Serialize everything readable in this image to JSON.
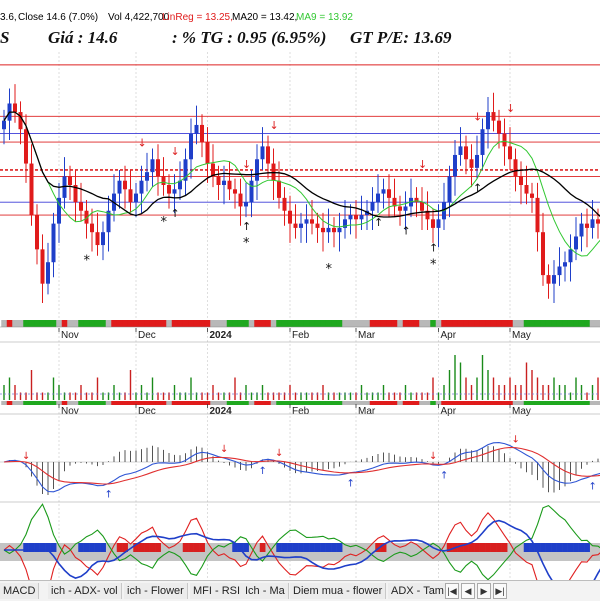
{
  "info_line": {
    "open_fragment": "3.6,",
    "close": "Close 14.6 (7.0%)",
    "vol": "Vol 4,422,700",
    "linreg": "LinReg = 13.25,",
    "ma20": "MA20 = 13.42,",
    "ma9": "MA9 = 13.92"
  },
  "headline": {
    "ticker_fragment": "S",
    "price": "Giá : 14.6",
    "change": ": % TG : 0.95 (6.95%)",
    "pe": "GT P/E: 13.69"
  },
  "colors": {
    "up": "#1f3fc9",
    "down": "#e01b1b",
    "ma20": "#000000",
    "ma9": "#32c832",
    "macd_line": "#2f55d4",
    "signal_line": "#e03030",
    "grid": "#c8c8c8",
    "band_blue": "#3a3ad8",
    "band_red": "#dd2020",
    "volume": "#1a8a1a"
  },
  "chart_data": [
    {
      "type": "candlestick",
      "title": "",
      "xlabel": "",
      "ylabel": "",
      "x_tick_labels": [
        "Nov",
        "Dec",
        "2024",
        "Feb",
        "Mar",
        "Apr",
        "May"
      ],
      "y_range": [
        10.6,
        16.8
      ],
      "price_values": [
        15.2,
        15.6,
        15.4,
        15.0,
        14.2,
        13.0,
        12.2,
        11.4,
        11.9,
        12.8,
        13.4,
        13.9,
        13.7,
        13.3,
        13.1,
        12.8,
        12.6,
        12.3,
        12.6,
        13.1,
        13.5,
        13.8,
        13.6,
        13.3,
        13.5,
        13.8,
        14.0,
        14.3,
        13.9,
        13.7,
        13.5,
        13.6,
        13.8,
        14.3,
        14.9,
        15.1,
        14.7,
        14.2,
        13.9,
        13.7,
        13.8,
        13.6,
        13.5,
        13.2,
        13.3,
        13.8,
        14.3,
        14.6,
        14.2,
        13.8,
        13.4,
        13.1,
        12.8,
        12.7,
        12.8,
        12.9,
        12.8,
        12.7,
        12.6,
        12.7,
        12.6,
        12.7,
        12.9,
        13.0,
        12.9,
        13.0,
        13.1,
        13.3,
        13.5,
        13.6,
        13.4,
        13.2,
        13.1,
        13.2,
        13.4,
        13.3,
        13.1,
        12.9,
        12.7,
        12.9,
        13.3,
        13.9,
        14.4,
        14.6,
        14.3,
        14.1,
        14.4,
        15.0,
        15.4,
        15.2,
        14.9,
        14.6,
        14.3,
        13.9,
        13.7,
        13.5,
        13.4,
        12.6,
        11.6,
        11.4,
        11.6,
        11.8,
        11.9,
        12.2,
        12.5,
        12.8,
        12.7,
        12.9,
        12.8,
        12.9,
        13.3
      ]
    },
    {
      "type": "bar",
      "title": "",
      "xlabel": "",
      "ylabel": "",
      "x_tick_labels": [
        "Nov",
        "Dec",
        "2024",
        "Feb",
        "Mar",
        "Apr",
        "May"
      ],
      "volume_values": [
        2,
        3,
        2,
        1,
        1,
        4,
        1,
        1,
        1,
        3,
        2,
        1,
        1,
        1,
        2,
        1,
        1,
        3,
        1,
        1,
        2,
        1,
        1,
        4,
        1,
        2,
        1,
        3,
        1,
        1,
        1,
        2,
        1,
        1,
        3,
        1,
        1,
        1,
        2,
        1,
        1,
        1,
        3,
        1,
        2,
        1,
        1,
        2,
        1,
        1,
        1,
        1,
        2,
        1,
        1,
        1,
        1,
        1,
        2,
        1,
        1,
        1,
        1,
        1,
        1,
        2,
        1,
        1,
        1,
        2,
        1,
        1,
        1,
        2,
        1,
        1,
        1,
        1,
        3,
        1,
        2,
        4,
        6,
        5,
        3,
        2,
        3,
        6,
        4,
        3,
        2,
        2,
        3,
        2,
        2,
        5,
        4,
        3,
        2,
        2,
        3,
        2,
        2,
        1,
        3,
        2,
        1,
        2,
        3,
        2
      ]
    }
  ],
  "tabs": [
    "MACD",
    "ich - ADX- vol",
    "ich - Flower",
    "MFI - RSI",
    "Ich - Ma",
    "Diem mua - flower",
    "ADX - Tam"
  ],
  "nav": {
    "first": "|◀",
    "prev": "◀",
    "next": "▶",
    "last": "▶|"
  }
}
